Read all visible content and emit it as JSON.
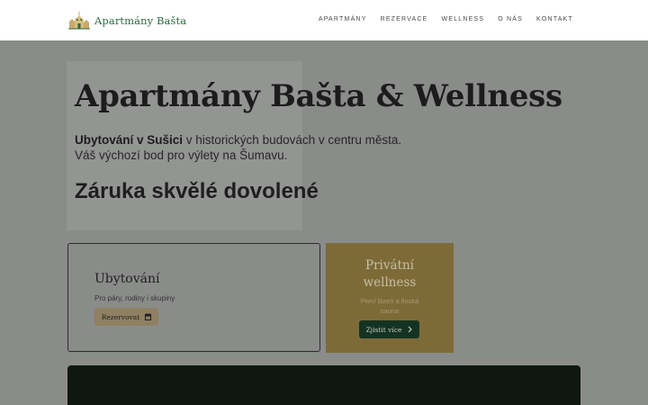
{
  "header": {
    "logo_text": "Apartmány Bašta",
    "nav": [
      "Apartmány",
      "Rezervace",
      "Wellness",
      "O nás",
      "Kontakt"
    ]
  },
  "hero": {
    "title": "Apartmány Bašta & Wellness",
    "line1_bold": "Ubytování v Sušici",
    "line1_rest": " v historických budovách v centru města.",
    "line2": "Váš výchozí bod pro výlety na Šumavu.",
    "subtitle": "Záruka skvělé dovolené"
  },
  "cards": {
    "accommodation": {
      "title": "Ubytování",
      "description": "Pro páry, rodiny i skupiny",
      "button": "Rezervovat",
      "button_icon": "calendar-icon"
    },
    "wellness": {
      "title_line1": "Privátní",
      "title_line2": "wellness",
      "description_line1": "Pivní lázeň a finská",
      "description_line2": "sauna",
      "button": "Zjistit více",
      "button_icon": "chevron-right-icon"
    }
  },
  "colors": {
    "overlay": "#8a8c8a",
    "brand_green": "#2c6b3d",
    "gold": "#7d6b37",
    "dark_green": "#143322",
    "reserve_button": "#8f7f63"
  }
}
